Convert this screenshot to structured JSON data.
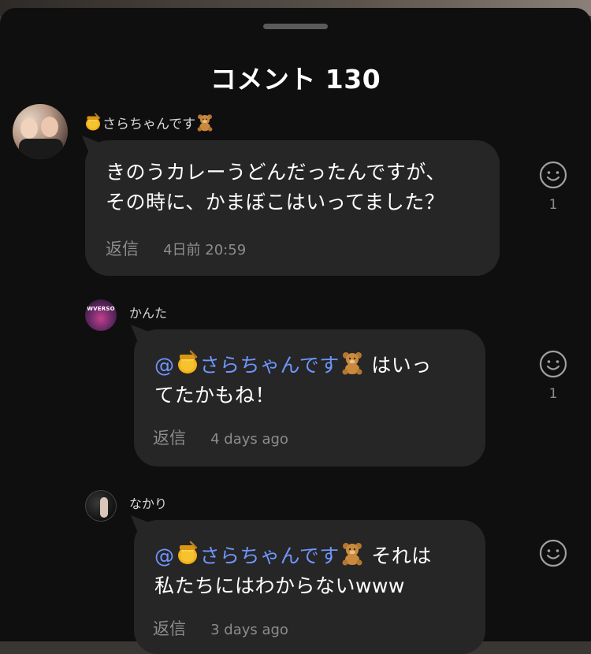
{
  "sheet": {
    "title": "コメント 130"
  },
  "icons": {
    "honey_pot": "honey-pot-emoji",
    "bear": "teddy-bear-emoji",
    "smiley": "smiley-react-icon"
  },
  "colors": {
    "background": "#0f0f0f",
    "bubble": "#262626",
    "mention": "#6f95ff",
    "meta": "#8c8c8c"
  },
  "comments": [
    {
      "username": "さらちゃんです",
      "body_line1": "きのうカレーうどんだったんですが、",
      "body_line2": "その時に、かまぼこはいってました？",
      "reply_label": "返信",
      "timestamp": "4日前 20:59",
      "reaction_count": "1"
    },
    {
      "username": "かんた",
      "avatar_text": "WVERSO",
      "mention": "@",
      "mention_name": "さらちゃんです",
      "body_after_mention": " はいっ",
      "body_line2": "てたかもね！",
      "reply_label": "返信",
      "timestamp": "4 days ago",
      "reaction_count": "1"
    },
    {
      "username": "なかり",
      "mention": "@",
      "mention_name": "さらちゃんです",
      "body_after_mention": " それは",
      "body_line2": "私たちにはわからないwww",
      "reply_label": "返信",
      "timestamp": "3 days ago",
      "reaction_count": ""
    }
  ]
}
